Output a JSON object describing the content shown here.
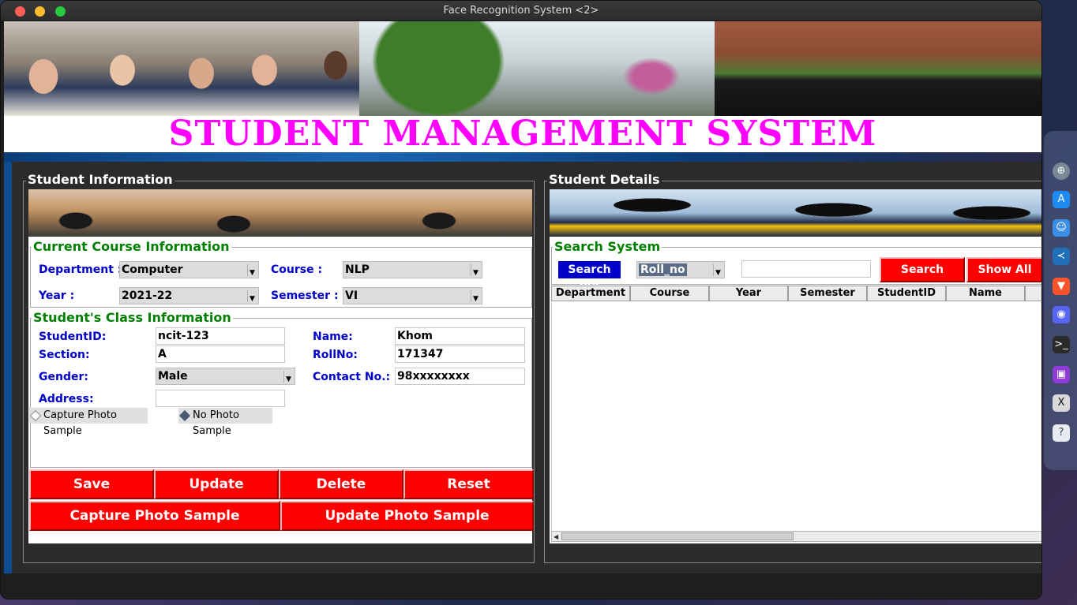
{
  "window": {
    "title": "Face Recognition System <2>"
  },
  "header": {
    "main_title": "STUDENT MANAGEMENT SYSTEM"
  },
  "left_panel": {
    "frame_title": "Student Information",
    "course_section": {
      "title": "Current Course Information",
      "department_label": "Department :",
      "department_value": "Computer",
      "course_label": "Course :",
      "course_value": "NLP",
      "year_label": "Year :",
      "year_value": "2021-22",
      "semester_label": "Semester :",
      "semester_value": "VI"
    },
    "class_section": {
      "title": "Student's Class Information",
      "student_id_label": "StudentID:",
      "student_id_value": "ncit-123",
      "name_label": "Name:",
      "name_value": "Khom",
      "section_label": "Section:",
      "section_value": "A",
      "roll_label": "RollNo:",
      "roll_value": "171347",
      "gender_label": "Gender:",
      "gender_value": "Male",
      "contact_label": "Contact No.:",
      "contact_value": "98xxxxxxxx",
      "address_label": "Address:",
      "address_value": "",
      "radio_capture": "Capture Photo Sample",
      "radio_no_photo": "No Photo Sample"
    },
    "buttons": {
      "save": "Save",
      "update": "Update",
      "delete": "Delete",
      "reset": "Reset",
      "capture_photo": "Capture Photo Sample",
      "update_photo": "Update Photo Sample"
    }
  },
  "right_panel": {
    "frame_title": "Student Details",
    "search_section": {
      "title": "Search System",
      "search_by_label": "Search By:",
      "search_by_value": "Roll_no",
      "search_input_value": "",
      "search_button": "Search",
      "show_all_button": "Show All"
    },
    "table": {
      "columns": [
        "Department",
        "Course",
        "Year",
        "Semester",
        "StudentID",
        "Name"
      ],
      "rows": []
    }
  },
  "dock": {
    "items": [
      "apple-icon",
      "launchpad-icon",
      "app-store-icon",
      "finder-icon",
      "vscode-icon",
      "brave-icon",
      "discord-icon",
      "terminal-icon",
      "camera-icon",
      "xquartz-icon",
      "help-icon"
    ]
  },
  "colors": {
    "title_magenta": "#ff00ff",
    "section_green": "#008000",
    "label_blue": "#0000c8",
    "button_red": "#ff0000"
  }
}
